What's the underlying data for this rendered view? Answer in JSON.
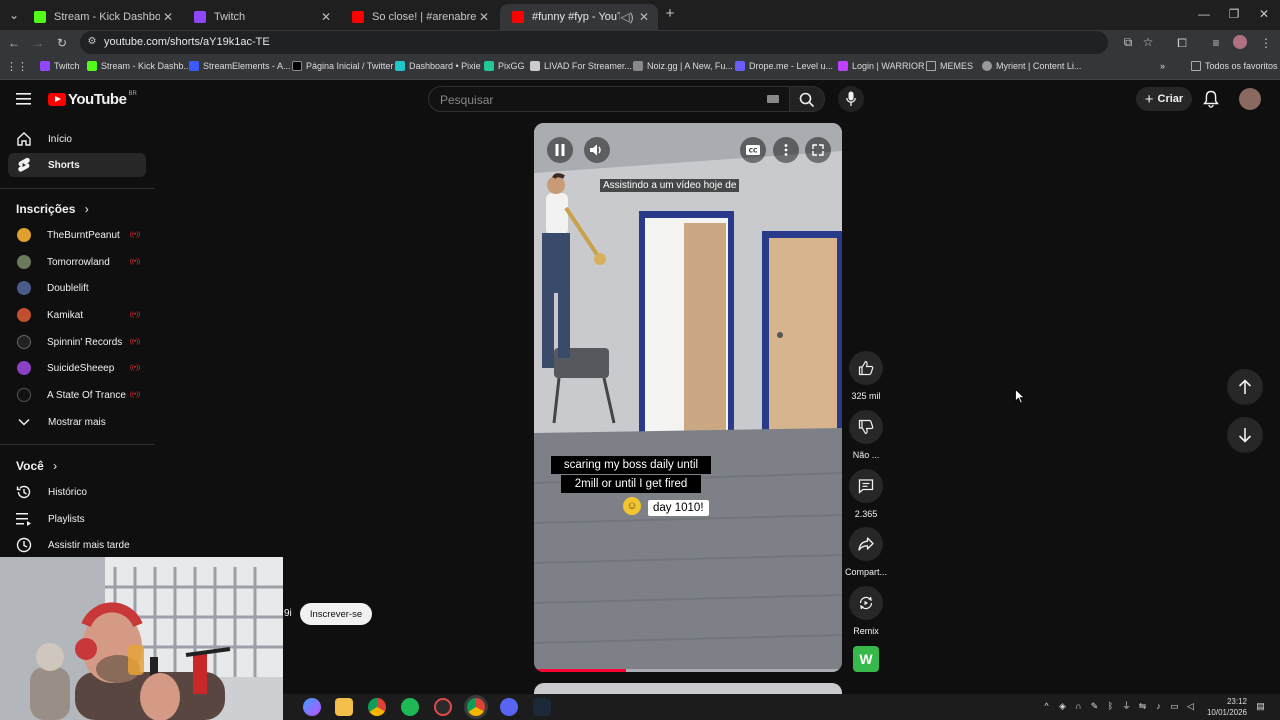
{
  "browser": {
    "tabs": [
      {
        "title": "Stream - Kick Dashboard",
        "color": "#53fc18"
      },
      {
        "title": "Twitch",
        "color": "#9146ff"
      },
      {
        "title": "So close! | #arenabreakoutinfin",
        "color": "#ff0000"
      },
      {
        "title": "#funny #fyp - YouTube",
        "color": "#ff0000"
      }
    ],
    "new_tab_glyph": "+",
    "url": "youtube.com/shorts/aY19k1ac-TE",
    "bookmarks": [
      {
        "label": "Twitch",
        "color": "#9146ff"
      },
      {
        "label": "Stream - Kick Dashb...",
        "color": "#53fc18"
      },
      {
        "label": "StreamElements - A...",
        "color": "#3a5bff"
      },
      {
        "label": "Página Inicial / Twitter",
        "color": "#000000"
      },
      {
        "label": "Dashboard • Pixie",
        "color": "#1fc8c8"
      },
      {
        "label": "PixGG",
        "color": "#20c997"
      },
      {
        "label": "LIVAD For Streamer...",
        "color": "#cccccc"
      },
      {
        "label": "Noiz.gg | A New, Fu...",
        "color": "#888888"
      },
      {
        "label": "Drope.me - Level u...",
        "color": "#6a5cff"
      },
      {
        "label": "Login | WARRIOR",
        "color": "#c040ff"
      },
      {
        "label": "MEMES",
        "color": "#aaaaaa"
      },
      {
        "label": "Myrient | Content Li...",
        "color": "#999999"
      }
    ],
    "all_bookmarks": "Todos os favoritos"
  },
  "youtube": {
    "logo_text": "YouTube",
    "country_code": "BR",
    "search_placeholder": "Pesquisar",
    "create_label": "Criar",
    "sidebar": {
      "home": "Início",
      "shorts": "Shorts",
      "subscriptions_title": "Inscrições",
      "channels": [
        {
          "name": "TheBurntPeanut",
          "color": "#e0a030"
        },
        {
          "name": "Tomorrowland",
          "color": "#6a7a5a"
        },
        {
          "name": "Doublelift",
          "color": "#4a5a8a"
        },
        {
          "name": "Kamikat",
          "color": "#c05030"
        },
        {
          "name": "Spinnin' Records",
          "color": "#222222"
        },
        {
          "name": "SuicideSheeep",
          "color": "#8a40c0"
        },
        {
          "name": "A State Of Trance",
          "color": "#111111"
        }
      ],
      "show_more": "Mostrar mais",
      "you_title": "Você",
      "history": "Histórico",
      "playlists": "Playlists",
      "watch_later": "Assistir mais tarde"
    },
    "video": {
      "caption_top": "Assistindo a um vídeo hoje de",
      "caption_line1": "scaring my boss daily until",
      "caption_line2": "2mill or until I get fired",
      "caption_day": "day 1010!",
      "progress": 0.3
    },
    "actions": {
      "likes": "325 mil",
      "dislike": "Não ...",
      "comments": "2.365",
      "share": "Compart...",
      "remix": "Remix",
      "channel_badge": "W"
    },
    "subscribe_label": "Inscrever-se",
    "overlay_text": "9i"
  },
  "taskbar": {
    "time": "23:12",
    "date": "10/01/2026"
  }
}
